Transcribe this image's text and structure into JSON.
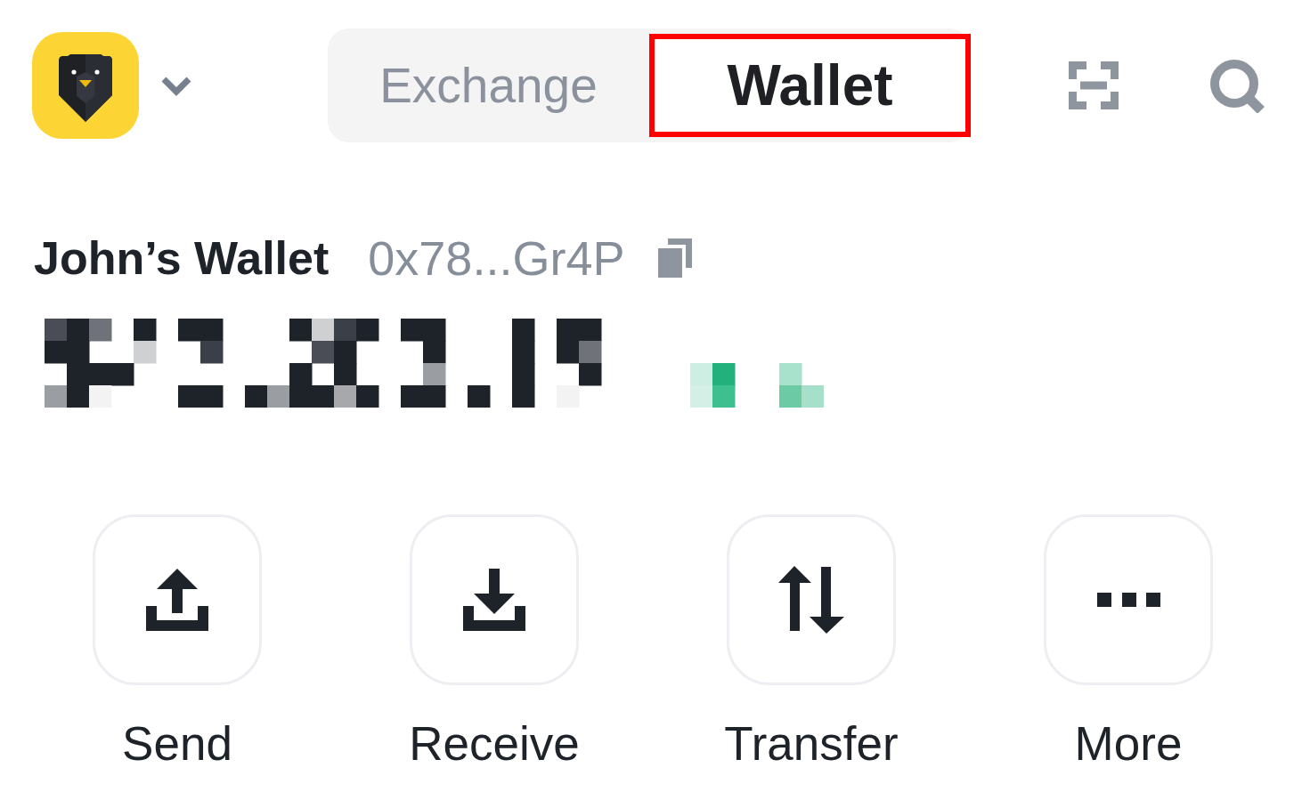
{
  "tabs": [
    {
      "label": "Exchange",
      "selected": false,
      "highlighted": false
    },
    {
      "label": "Wallet",
      "selected": true,
      "highlighted": true
    }
  ],
  "wallet": {
    "name": "John’s Wallet",
    "address": "0x78...Gr4P"
  },
  "actions": [
    {
      "label": "Send",
      "kind": "send"
    },
    {
      "label": "Receive",
      "kind": "receive"
    },
    {
      "label": "Transfer",
      "kind": "transfer"
    },
    {
      "label": "More",
      "kind": "more"
    }
  ]
}
